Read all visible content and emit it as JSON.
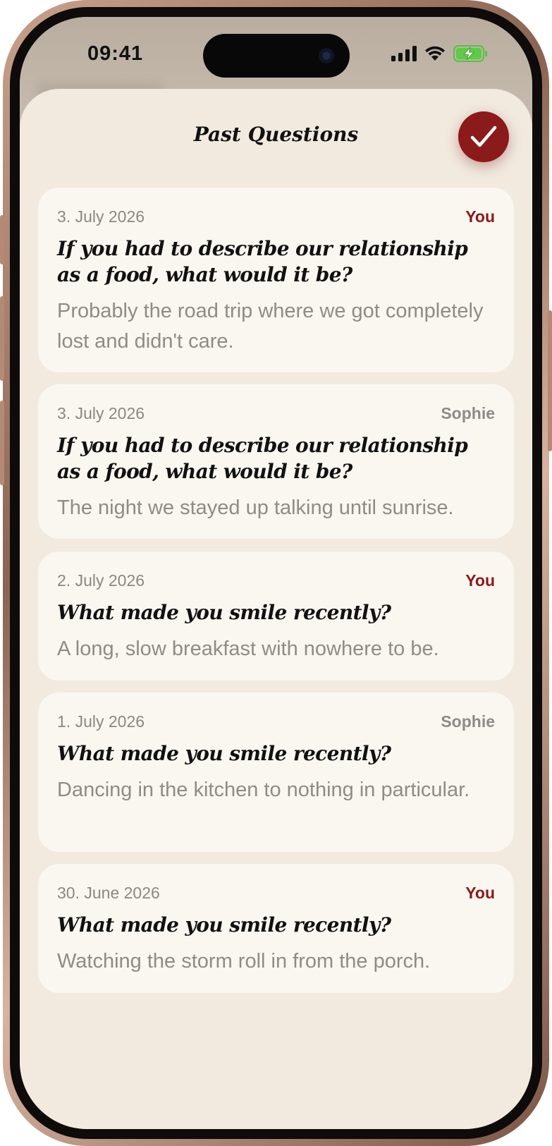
{
  "status_bar": {
    "time": "09:41"
  },
  "sheet": {
    "title": "Past Questions",
    "done_label": "Done"
  },
  "entries": [
    {
      "date": "3. July 2026",
      "author": "You",
      "question": "If you had to describe our relationship as a food, what would it be?",
      "answer": "Probably the road trip where we got completely lost and didn't care."
    },
    {
      "date": "3. July 2026",
      "author": "Sophie",
      "question": "If you had to describe our relationship as a food, what would it be?",
      "answer": "The night we stayed up talking until sunrise."
    },
    {
      "date": "2. July 2026",
      "author": "You",
      "question": "What made you smile recently?",
      "answer": "A long, slow breakfast with nowhere to be."
    },
    {
      "date": "1. July 2026",
      "author": "Sophie",
      "question": "What made you smile recently?",
      "answer": "Dancing in the kitchen to nothing in particular."
    },
    {
      "date": "30. June 2026",
      "author": "You",
      "question": "What made you smile recently?",
      "answer": "Watching the storm roll in from the porch."
    }
  ],
  "colors": {
    "accent": "#8b1a1a",
    "sheet_bg": "#f2eadf",
    "card_bg": "#faf7f1"
  }
}
